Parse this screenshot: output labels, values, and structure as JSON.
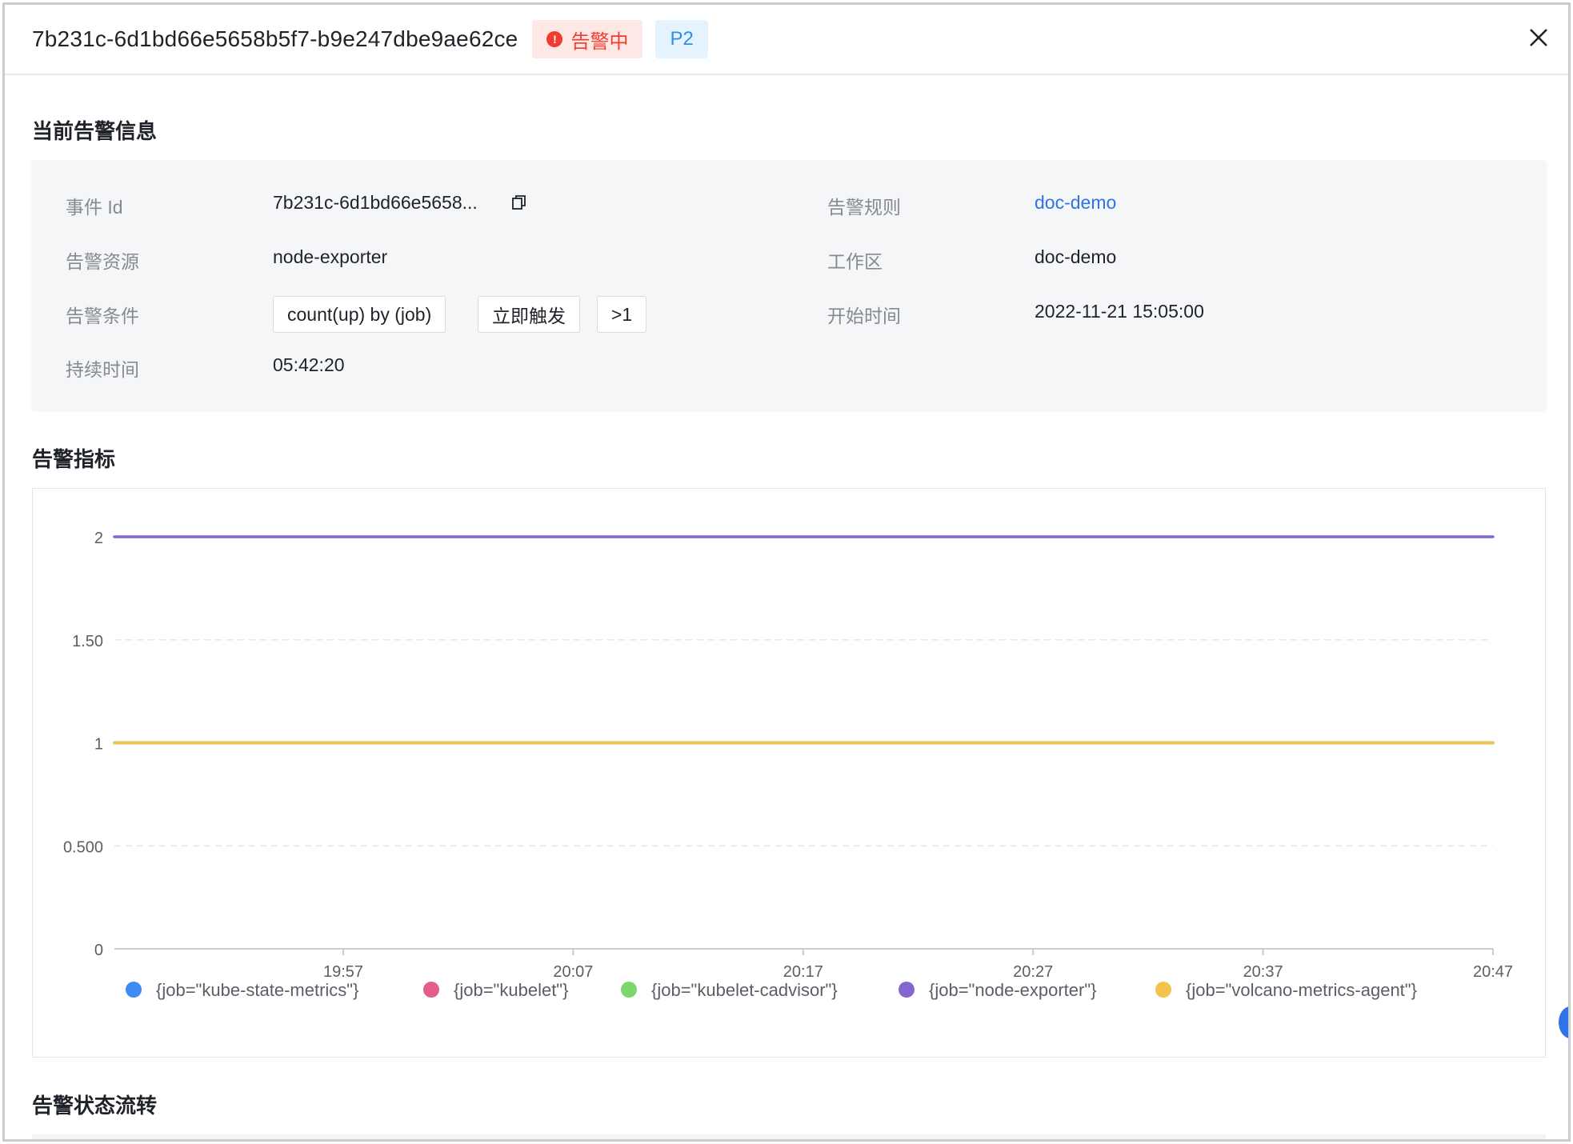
{
  "header": {
    "title": "7b231c-6d1bd66e5658b5f7-b9e247dbe9ae62ce",
    "status_tag": "告警中",
    "level_tag": "P2"
  },
  "sections": {
    "current_info": "当前告警信息",
    "metrics": "告警指标",
    "status_flow": "告警状态流转"
  },
  "info": {
    "event_id_label": "事件 Id",
    "event_id_value": "7b231c-6d1bd66e5658...",
    "rule_label": "告警规则",
    "rule_value": "doc-demo",
    "source_label": "告警资源",
    "source_value": "node-exporter",
    "workspace_label": "工作区",
    "workspace_value": "doc-demo",
    "condition_label": "告警条件",
    "condition_chips": [
      "count(up) by (job)",
      "立即触发",
      ">1"
    ],
    "start_label": "开始时间",
    "start_value": "2022-11-21 15:05:00",
    "duration_label": "持续时间",
    "duration_value": "05:42:20"
  },
  "colors": {
    "alert_red": "#f23b2f",
    "level_blue": "#2f8fe6",
    "link_blue": "#2f73e6"
  },
  "chart_data": {
    "type": "line",
    "x_ticks": [
      "19:57",
      "20:07",
      "20:17",
      "20:27",
      "20:37",
      "20:47"
    ],
    "y_ticks": [
      "0",
      "0.500",
      "1",
      "1.50",
      "2"
    ],
    "ylim": [
      0,
      2
    ],
    "grid": true,
    "legend_position": "bottom",
    "series": [
      {
        "name": "{job=\"kube-state-metrics\"}",
        "color": "#3d8bf5",
        "values": [
          1,
          1
        ]
      },
      {
        "name": "{job=\"kubelet\"}",
        "color": "#e35d8a",
        "values": [
          1,
          1
        ]
      },
      {
        "name": "{job=\"kubelet-cadvisor\"}",
        "color": "#7dd66b",
        "values": [
          1,
          1
        ]
      },
      {
        "name": "{job=\"node-exporter\"}",
        "color": "#8466cf",
        "values": [
          2,
          2
        ]
      },
      {
        "name": "{job=\"volcano-metrics-agent\"}",
        "color": "#f2c44b",
        "values": [
          1,
          1
        ]
      }
    ]
  }
}
